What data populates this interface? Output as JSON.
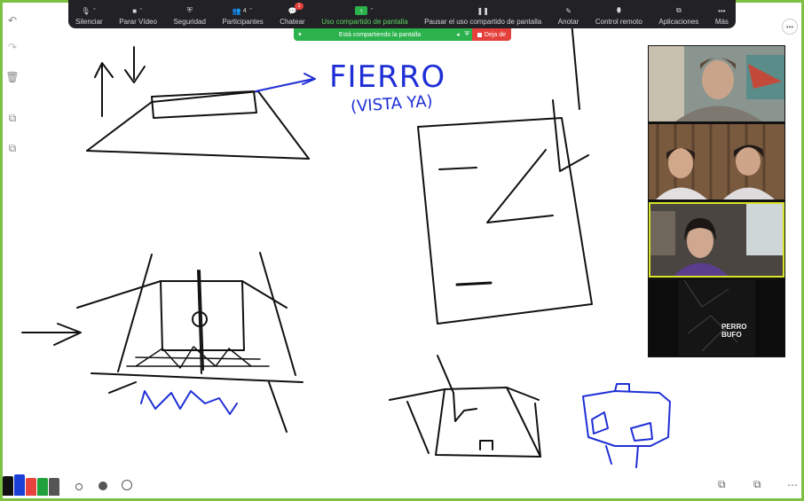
{
  "toolbar": {
    "items": [
      {
        "label": "Silenciar",
        "icon": "microphone-icon"
      },
      {
        "label": "Parar Vídeo",
        "icon": "video-camera-icon"
      },
      {
        "label": "Seguridad",
        "icon": "shield-icon"
      },
      {
        "label": "Participantes",
        "icon": "participants-icon",
        "count": "4"
      },
      {
        "label": "Chatear",
        "icon": "chat-icon",
        "badge": "1"
      },
      {
        "label": "Uso compartido de pantalla",
        "icon": "share-screen-icon"
      },
      {
        "label": "Pausar el uso compartido de pantalla",
        "icon": "pause-icon"
      },
      {
        "label": "Anotar",
        "icon": "pen-icon"
      },
      {
        "label": "Control remoto",
        "icon": "mouse-icon"
      },
      {
        "label": "Aplicaciones",
        "icon": "apps-icon"
      },
      {
        "label": "Más",
        "icon": "more-icon"
      }
    ]
  },
  "banner": {
    "text": "Está compartiendo la pantalla",
    "stop_label": "Deja de"
  },
  "whiteboard": {
    "annotation_title": "FIERRO",
    "annotation_subtitle": "(VISTA YA)"
  },
  "gallery": {
    "tiles": [
      {
        "name": "participant-1",
        "bg": "#6b7f86"
      },
      {
        "name": "participant-2",
        "bg": "#8a6a4c"
      },
      {
        "name": "participant-3",
        "bg": "#4d4a44"
      },
      {
        "name": "participant-4",
        "bg": "#0c0c0c",
        "text": "PERRO BUFO"
      }
    ]
  },
  "palette": {
    "colors": [
      "#111111",
      "#1a3fd6",
      "#e8433d",
      "#20a13c",
      "#555555"
    ]
  },
  "accent_colors": {
    "zoom_green": "#2bb24c",
    "stop_red": "#e5403b",
    "frame_green": "#7cc142",
    "ink_blue": "#1f2fd6"
  }
}
